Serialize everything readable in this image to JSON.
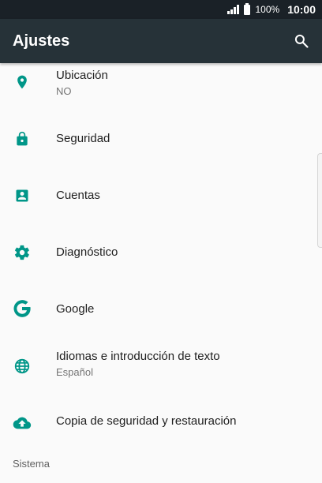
{
  "status_bar": {
    "battery_percent": "100%",
    "time": "10:00"
  },
  "app_bar": {
    "title": "Ajustes",
    "search_icon": "search-icon"
  },
  "accent_color": "#009688",
  "items": [
    {
      "id": "location",
      "icon": "location-pin-icon",
      "label": "Ubicación",
      "summary": "NO"
    },
    {
      "id": "security",
      "icon": "lock-icon",
      "label": "Seguridad",
      "summary": ""
    },
    {
      "id": "accounts",
      "icon": "account-box-icon",
      "label": "Cuentas",
      "summary": ""
    },
    {
      "id": "diagnostics",
      "icon": "gear-icon",
      "label": "Diagnóstico",
      "summary": ""
    },
    {
      "id": "google",
      "icon": "google-icon",
      "label": "Google",
      "summary": ""
    },
    {
      "id": "languages",
      "icon": "globe-icon",
      "label": "Idiomas e introducción de texto",
      "summary": "Español"
    },
    {
      "id": "backup",
      "icon": "cloud-upload-icon",
      "label": "Copia de seguridad y restauración",
      "summary": ""
    }
  ],
  "section_system": "Sistema"
}
